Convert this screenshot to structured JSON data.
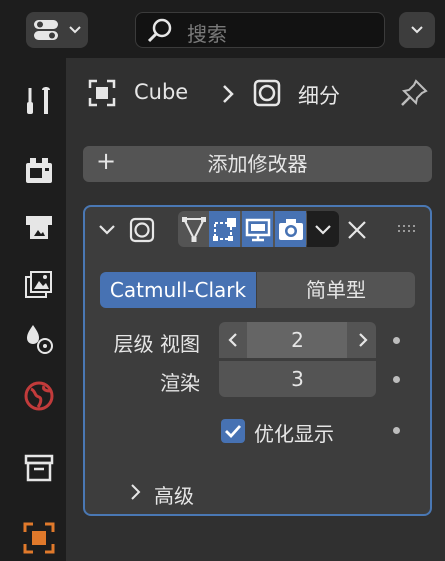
{
  "header": {
    "search_placeholder": "搜索"
  },
  "breadcrumb": {
    "object_name": "Cube",
    "modifier_name": "细分"
  },
  "modifiers": {
    "add_label": "添加修改器"
  },
  "subdivision": {
    "method_options": [
      "Catmull-Clark",
      "简单型"
    ],
    "method_selected": "Catmull-Clark",
    "levels_viewport_label": "层级 视图",
    "levels_viewport_value": "2",
    "render_label": "渲染",
    "render_value": "3",
    "optimal_display_label": "优化显示",
    "optimal_display_checked": true,
    "advanced_label": "高级"
  },
  "colors": {
    "accent": "#4772b3",
    "panel_border": "#4a78b4",
    "background": "#303030",
    "sidebar": "#1d1d1d"
  }
}
